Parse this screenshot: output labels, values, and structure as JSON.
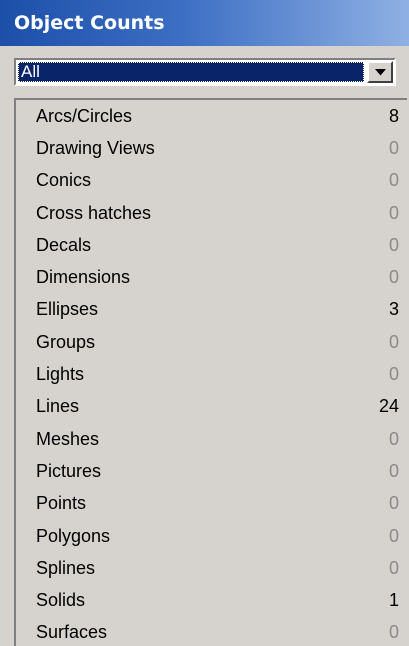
{
  "panel": {
    "title": "Object Counts"
  },
  "filter": {
    "selected": "All"
  },
  "items": [
    {
      "label": "Arcs/Circles",
      "count": "8"
    },
    {
      "label": "Drawing Views",
      "count": "0"
    },
    {
      "label": "Conics",
      "count": "0"
    },
    {
      "label": "Cross hatches",
      "count": "0"
    },
    {
      "label": "Decals",
      "count": "0"
    },
    {
      "label": "Dimensions",
      "count": "0"
    },
    {
      "label": "Ellipses",
      "count": "3"
    },
    {
      "label": "Groups",
      "count": "0"
    },
    {
      "label": "Lights",
      "count": "0"
    },
    {
      "label": "Lines",
      "count": "24"
    },
    {
      "label": "Meshes",
      "count": "0"
    },
    {
      "label": "Pictures",
      "count": "0"
    },
    {
      "label": "Points",
      "count": "0"
    },
    {
      "label": "Polygons",
      "count": "0"
    },
    {
      "label": "Splines",
      "count": "0"
    },
    {
      "label": "Solids",
      "count": "1"
    },
    {
      "label": "Surfaces",
      "count": "0"
    }
  ],
  "colors": {
    "title_gradient_start": "#1c4fa8",
    "title_gradient_end": "#8fb0e3",
    "selection": "#0a246a",
    "zero_count": "#8a8a8a",
    "face": "#d6d3ce"
  },
  "icons": {
    "dropdown": "chevron-down-icon"
  }
}
